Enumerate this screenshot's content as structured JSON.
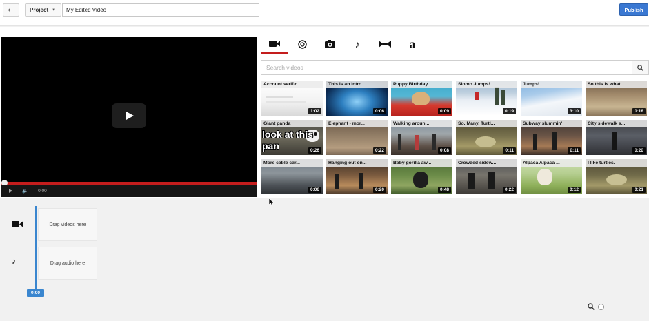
{
  "header": {
    "back_icon": "back-arrow-icon",
    "project_label": "Project",
    "project_caret": "▼",
    "title_value": "My Edited Video",
    "publish_label": "Publish"
  },
  "player": {
    "time": "0:00",
    "progress_fraction": 0.0,
    "accent": "#c41d1d"
  },
  "tabs": [
    {
      "name": "video-camera-icon",
      "active": true
    },
    {
      "name": "creative-commons-icon",
      "active": false
    },
    {
      "name": "photo-camera-icon",
      "active": false
    },
    {
      "name": "music-note-icon",
      "active": false
    },
    {
      "name": "transition-icon",
      "active": false
    },
    {
      "name": "text-icon",
      "label": "a",
      "active": false
    }
  ],
  "search": {
    "placeholder": "Search videos",
    "icon": "search-icon"
  },
  "videos": [
    {
      "title": "Account verific...",
      "duration": "1:02"
    },
    {
      "title": "This is an intro",
      "duration": "0:06"
    },
    {
      "title": "Puppy Birthday...",
      "duration": "0:09"
    },
    {
      "title": "Slomo Jumps!",
      "duration": "0:19"
    },
    {
      "title": "Jumps!",
      "duration": "3:10"
    },
    {
      "title": "So this is what ...",
      "duration": "0:18"
    },
    {
      "title": "Giant panda",
      "duration": "0:26",
      "overlay": "look at this pan"
    },
    {
      "title": "Elephant - mor...",
      "duration": "0:22"
    },
    {
      "title": "Walking aroun...",
      "duration": "0:08"
    },
    {
      "title": "So. Many. Turtl...",
      "duration": "0:11"
    },
    {
      "title": "Subway slummin'",
      "duration": "0:11"
    },
    {
      "title": "City sidewalk a...",
      "duration": "0:20"
    },
    {
      "title": "More cable car...",
      "duration": "0:06"
    },
    {
      "title": "Hanging out on...",
      "duration": "0:20"
    },
    {
      "title": "Baby gorilla aw...",
      "duration": "0:48"
    },
    {
      "title": "Crowded sidew...",
      "duration": "0:22"
    },
    {
      "title": "Alpaca Alpaca ...",
      "duration": "0:12"
    },
    {
      "title": "I like turtles.",
      "duration": "0:21"
    }
  ],
  "timeline": {
    "video_track_label": "Drag videos here",
    "audio_track_label": "Drag audio here",
    "playhead_time": "0:00",
    "accent": "#3a86cf",
    "zoom_icon": "zoom-icon"
  }
}
